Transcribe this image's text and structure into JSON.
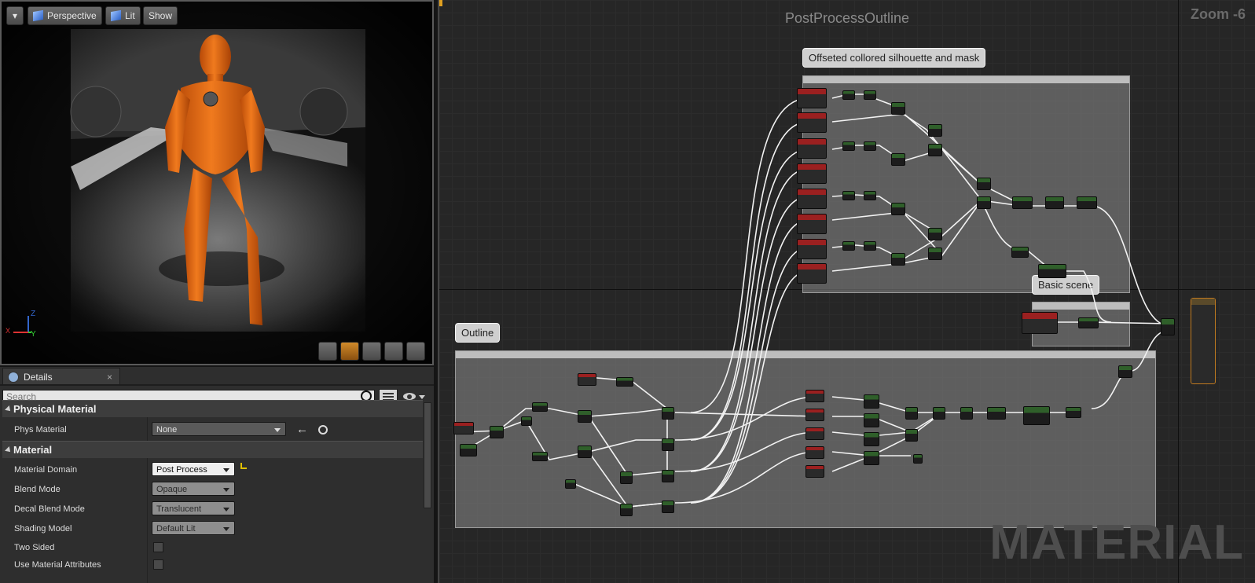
{
  "viewport": {
    "menu_glyph": "▾",
    "perspective_label": "Perspective",
    "lit_label": "Lit",
    "show_label": "Show",
    "axis_z": "Z",
    "axis_y": "Y",
    "axis_x": "X"
  },
  "details": {
    "tab_label": "Details",
    "tab_close": "×",
    "search_placeholder": "Search",
    "categories": {
      "physical_material": "Physical Material",
      "material": "Material"
    },
    "props": {
      "phys_material": {
        "label": "Phys Material",
        "value": "None"
      },
      "material_domain": {
        "label": "Material Domain",
        "value": "Post Process"
      },
      "blend_mode": {
        "label": "Blend Mode",
        "value": "Opaque"
      },
      "decal_blend_mode": {
        "label": "Decal Blend Mode",
        "value": "Translucent"
      },
      "shading_model": {
        "label": "Shading Model",
        "value": "Default Lit"
      },
      "two_sided": {
        "label": "Two Sided",
        "checked": false
      },
      "use_material_attributes": {
        "label": "Use Material Attributes",
        "checked": false
      }
    }
  },
  "graph": {
    "title": "PostProcessOutline",
    "zoom": "Zoom -6",
    "watermark": "MATERIAL",
    "comments": {
      "silhouette": "Offseted collored silhouette and mask",
      "basic_scene": "Basic scene",
      "outline": "Outline"
    }
  },
  "colors": {
    "accent_orange": "#e0701a",
    "node_red": "#9b2020",
    "node_green": "#2f5f2a",
    "wire": "#ffffff"
  }
}
